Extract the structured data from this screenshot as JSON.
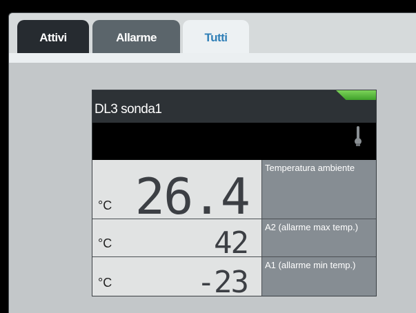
{
  "tabs": [
    {
      "label": "Attivi"
    },
    {
      "label": "Allarme"
    },
    {
      "label": "Tutti",
      "active": true
    }
  ],
  "device": {
    "name": "DL3 sonda1",
    "status_color": "#5cbf3c"
  },
  "readings": [
    {
      "unit": "°C",
      "value": "26.4",
      "label": "Temperatura ambiente"
    },
    {
      "unit": "°C",
      "value": "42",
      "label": "A2 (allarme max temp.)"
    },
    {
      "unit": "°C",
      "value": "-23",
      "label": "A1 (allarme min temp.)"
    }
  ],
  "icons": {
    "probe": "thermometer-icon"
  }
}
